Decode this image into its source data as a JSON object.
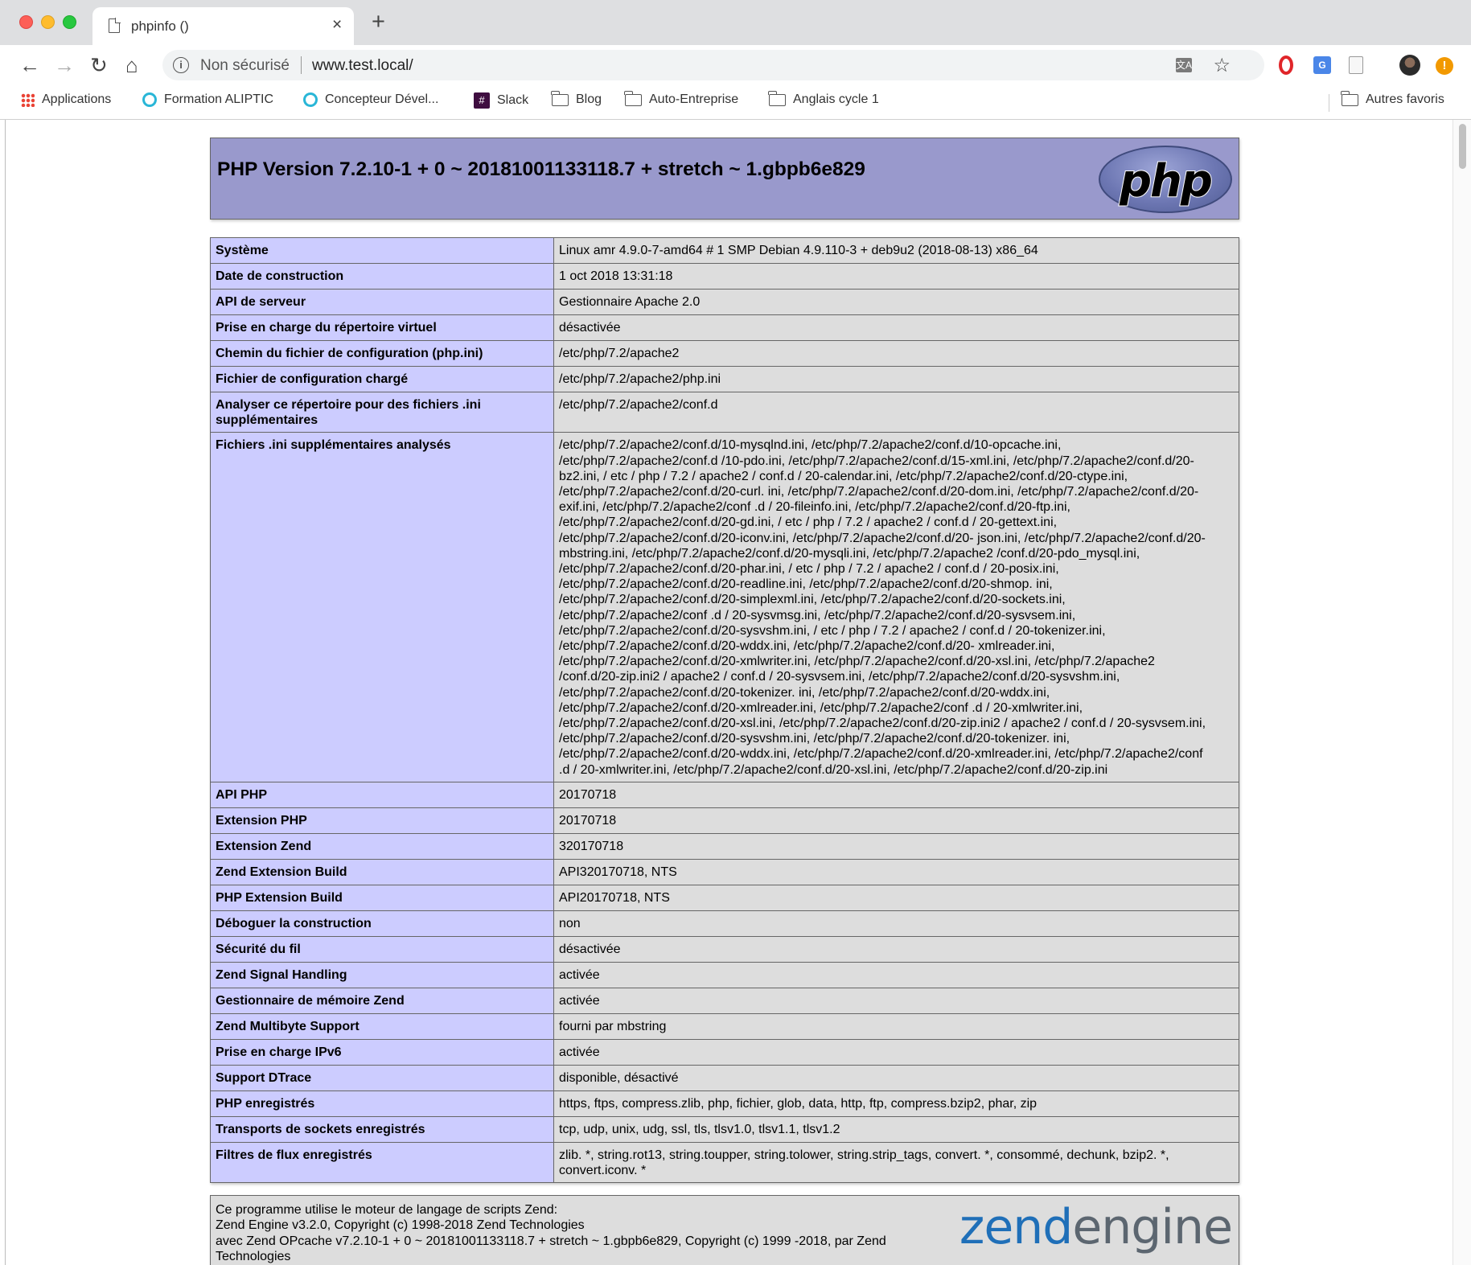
{
  "browser": {
    "tab_title": "phpinfo ()",
    "tab_close": "×",
    "new_tab": "+",
    "security_label": "Non sécurisé",
    "url": "www.test.local/",
    "bookmarks": [
      {
        "label": "Applications",
        "icon": "apps-grid-icon"
      },
      {
        "label": "Formation ALIPTIC",
        "icon": "ring-icon"
      },
      {
        "label": "Concepteur Dével...",
        "icon": "ring-icon"
      },
      {
        "label": "Slack",
        "icon": "slack-icon"
      },
      {
        "label": "Blog",
        "icon": "folder-icon"
      },
      {
        "label": "Auto-Entreprise",
        "icon": "folder-icon"
      },
      {
        "label": "Anglais cycle 1",
        "icon": "folder-icon"
      }
    ],
    "other_bookmarks": "Autres favoris"
  },
  "phpinfo": {
    "version_title": "PHP Version 7.2.10-1 + 0 ~ 20181001133118.7 + stretch ~ 1.gbpb6e829",
    "logo_text": "php",
    "rows": [
      {
        "key": "Système",
        "value": "Linux amr 4.9.0-7-amd64 # 1 SMP Debian 4.9.110-3 + deb9u2 (2018-08-13) x86_64"
      },
      {
        "key": "Date de construction",
        "value": "1 oct 2018 13:31:18"
      },
      {
        "key": "API de serveur",
        "value": "Gestionnaire Apache 2.0"
      },
      {
        "key": "Prise en charge du répertoire virtuel",
        "value": "désactivée"
      },
      {
        "key": "Chemin du fichier de configuration (php.ini)",
        "value": "/etc/php/7.2/apache2"
      },
      {
        "key": "Fichier de configuration chargé",
        "value": "/etc/php/7.2/apache2/php.ini"
      },
      {
        "key": "Analyser ce répertoire pour des fichiers .ini supplémentaires",
        "value": "/etc/php/7.2/apache2/conf.d"
      },
      {
        "key": "Fichiers .ini supplémentaires analysés",
        "value": "/etc/php/7.2/apache2/conf.d/10-mysqlnd.ini, /etc/php/7.2/apache2/conf.d/10-opcache.ini,\n/etc/php/7.2/apache2/conf.d /10-pdo.ini, /etc/php/7.2/apache2/conf.d/15-xml.ini, /etc/php/7.2/apache2/conf.d/20-\nbz2.ini, / etc / php / 7.2 / apache2 / conf.d / 20-calendar.ini, /etc/php/7.2/apache2/conf.d/20-ctype.ini,\n/etc/php/7.2/apache2/conf.d/20-curl. ini, /etc/php/7.2/apache2/conf.d/20-dom.ini, /etc/php/7.2/apache2/conf.d/20-\nexif.ini, /etc/php/7.2/apache2/conf .d / 20-fileinfo.ini, /etc/php/7.2/apache2/conf.d/20-ftp.ini,\n/etc/php/7.2/apache2/conf.d/20-gd.ini, / etc / php / 7.2 / apache2 / conf.d / 20-gettext.ini,\n/etc/php/7.2/apache2/conf.d/20-iconv.ini, /etc/php/7.2/apache2/conf.d/20- json.ini, /etc/php/7.2/apache2/conf.d/20-\nmbstring.ini, /etc/php/7.2/apache2/conf.d/20-mysqli.ini, /etc/php/7.2/apache2 /conf.d/20-pdo_mysql.ini,\n/etc/php/7.2/apache2/conf.d/20-phar.ini, / etc / php / 7.2 / apache2 / conf.d / 20-posix.ini,\n/etc/php/7.2/apache2/conf.d/20-readline.ini, /etc/php/7.2/apache2/conf.d/20-shmop. ini,\n/etc/php/7.2/apache2/conf.d/20-simplexml.ini, /etc/php/7.2/apache2/conf.d/20-sockets.ini,\n/etc/php/7.2/apache2/conf .d / 20-sysvmsg.ini, /etc/php/7.2/apache2/conf.d/20-sysvsem.ini,\n/etc/php/7.2/apache2/conf.d/20-sysvshm.ini, / etc / php / 7.2 / apache2 / conf.d / 20-tokenizer.ini,\n/etc/php/7.2/apache2/conf.d/20-wddx.ini, /etc/php/7.2/apache2/conf.d/20- xmlreader.ini,\n/etc/php/7.2/apache2/conf.d/20-xmlwriter.ini, /etc/php/7.2/apache2/conf.d/20-xsl.ini, /etc/php/7.2/apache2\n/conf.d/20-zip.ini2 / apache2 / conf.d / 20-sysvsem.ini, /etc/php/7.2/apache2/conf.d/20-sysvshm.ini,\n/etc/php/7.2/apache2/conf.d/20-tokenizer. ini, /etc/php/7.2/apache2/conf.d/20-wddx.ini,\n/etc/php/7.2/apache2/conf.d/20-xmlreader.ini, /etc/php/7.2/apache2/conf .d / 20-xmlwriter.ini,\n/etc/php/7.2/apache2/conf.d/20-xsl.ini, /etc/php/7.2/apache2/conf.d/20-zip.ini2 / apache2 / conf.d / 20-sysvsem.ini,\n/etc/php/7.2/apache2/conf.d/20-sysvshm.ini, /etc/php/7.2/apache2/conf.d/20-tokenizer. ini,\n/etc/php/7.2/apache2/conf.d/20-wddx.ini, /etc/php/7.2/apache2/conf.d/20-xmlreader.ini, /etc/php/7.2/apache2/conf\n.d / 20-xmlwriter.ini, /etc/php/7.2/apache2/conf.d/20-xsl.ini, /etc/php/7.2/apache2/conf.d/20-zip.ini"
      },
      {
        "key": "API PHP",
        "value": "20170718"
      },
      {
        "key": "Extension PHP",
        "value": "20170718"
      },
      {
        "key": "Extension Zend",
        "value": "320170718"
      },
      {
        "key": "Zend Extension Build",
        "value": "API320170718, NTS"
      },
      {
        "key": "PHP Extension Build",
        "value": "API20170718, NTS"
      },
      {
        "key": "Déboguer la construction",
        "value": "non"
      },
      {
        "key": "Sécurité du fil",
        "value": "désactivée"
      },
      {
        "key": "Zend Signal Handling",
        "value": "activée"
      },
      {
        "key": "Gestionnaire de mémoire Zend",
        "value": "activée"
      },
      {
        "key": "Zend Multibyte Support",
        "value": "fourni par mbstring"
      },
      {
        "key": "Prise en charge IPv6",
        "value": "activée"
      },
      {
        "key": "Support DTrace",
        "value": "disponible, désactivé"
      },
      {
        "key": "PHP enregistrés",
        "value": "https, ftps, compress.zlib, php, fichier, glob, data, http, ftp, compress.bzip2, phar, zip"
      },
      {
        "key": "Transports de sockets enregistrés",
        "value": "tcp, udp, unix, udg, ssl, tls, tlsv1.0, tlsv1.1, tlsv1.2"
      },
      {
        "key": "Filtres de flux enregistrés",
        "value": "zlib. *, string.rot13, string.toupper, string.tolower, string.strip_tags, convert. *, consommé, dechunk, bzip2. *,\nconvert.iconv. *"
      }
    ],
    "zend_text": "Ce programme utilise le moteur de langage de scripts Zend:\nZend Engine v3.2.0, Copyright (c) 1998-2018 Zend Technologies\n    avec Zend OPcache v7.2.10-1 + 0 ~ 20181001133118.7 + stretch ~ 1.gbpb6e829, Copyright (c) 1999 -2018, par Zend\nTechnologies",
    "zend_logo_word1": "zend",
    "zend_logo_word2": "engine"
  },
  "colors": {
    "header_bg": "#9999cc",
    "key_cell_bg": "#ccccff",
    "value_cell_bg": "#dddddd"
  }
}
